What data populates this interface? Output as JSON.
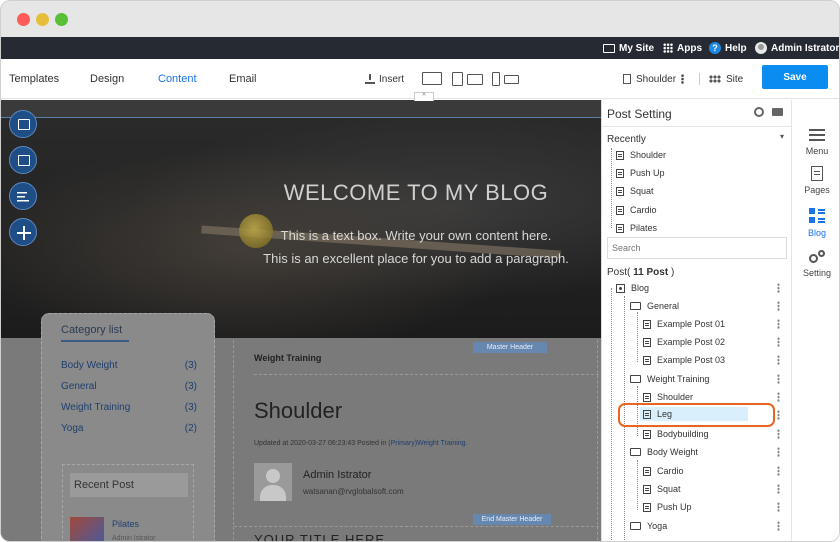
{
  "topbar": {
    "my_site": "My Site",
    "apps": "Apps",
    "help": "Help",
    "help_glyph": "?",
    "user": "Admin Istrator"
  },
  "toolbar": {
    "tabs": [
      "Templates",
      "Design",
      "Content",
      "Email"
    ],
    "active_tab": "Content",
    "insert": "Insert",
    "page_select": "Shoulder",
    "site_select": "Site",
    "save": "Save",
    "collapse_glyph": "^"
  },
  "hero": {
    "title": "WELCOME TO MY BLOG",
    "text_line1": "This is a text box. Write your own content here.",
    "text_line2": "This is an excellent place for you to add a paragraph."
  },
  "category_list": {
    "title": "Category list",
    "items": [
      {
        "label": "Body Weight",
        "count": "(3)"
      },
      {
        "label": "General",
        "count": "(3)"
      },
      {
        "label": "Weight Training",
        "count": "(3)"
      },
      {
        "label": "Yoga",
        "count": "(2)"
      }
    ]
  },
  "recent_post": {
    "title": "Recent Post",
    "item_title": "Pilates",
    "item_sub": "Admin Istrator"
  },
  "post": {
    "master_header": "Master Header",
    "category": "Weight Training",
    "title": "Shoulder",
    "meta_prefix": "Updated at 2020-03-27 06:23:43 Posted in",
    "meta_link": "(Primary)Weight Training",
    "meta_suffix": ".",
    "author_name": "Admin Istrator",
    "author_email": "watsanan@rvglobalsoft.com",
    "end_master_header": "End Master Header",
    "section_title": "YOUR TITLE HERE"
  },
  "panel": {
    "title": "Post Setting",
    "recently_label": "Recently",
    "caret": "▾",
    "recently": [
      "Shoulder",
      "Push Up",
      "Squat",
      "Cardio",
      "Pilates"
    ],
    "search_placeholder": "Search",
    "post_count_prefix": "Post(",
    "post_count": "11 Post",
    "post_count_suffix": ")",
    "tree": {
      "root": "Blog",
      "general": "General",
      "general_posts": [
        "Example Post 01",
        "Example Post 02",
        "Example Post 03"
      ],
      "weight_training": "Weight Training",
      "weight_training_posts": [
        "Shoulder",
        "Leg",
        "Bodybuilding"
      ],
      "body_weight": "Body Weight",
      "body_weight_posts": [
        "Cardio",
        "Squat",
        "Push Up"
      ],
      "yoga": "Yoga"
    },
    "selected": "Leg"
  },
  "rail": {
    "menu": "Menu",
    "pages": "Pages",
    "blog": "Blog",
    "setting": "Setting"
  },
  "colors": {
    "accent": "#1a73e8",
    "save": "#0a8cf0",
    "highlight": "#e8651f",
    "topbar": "#262b33"
  }
}
